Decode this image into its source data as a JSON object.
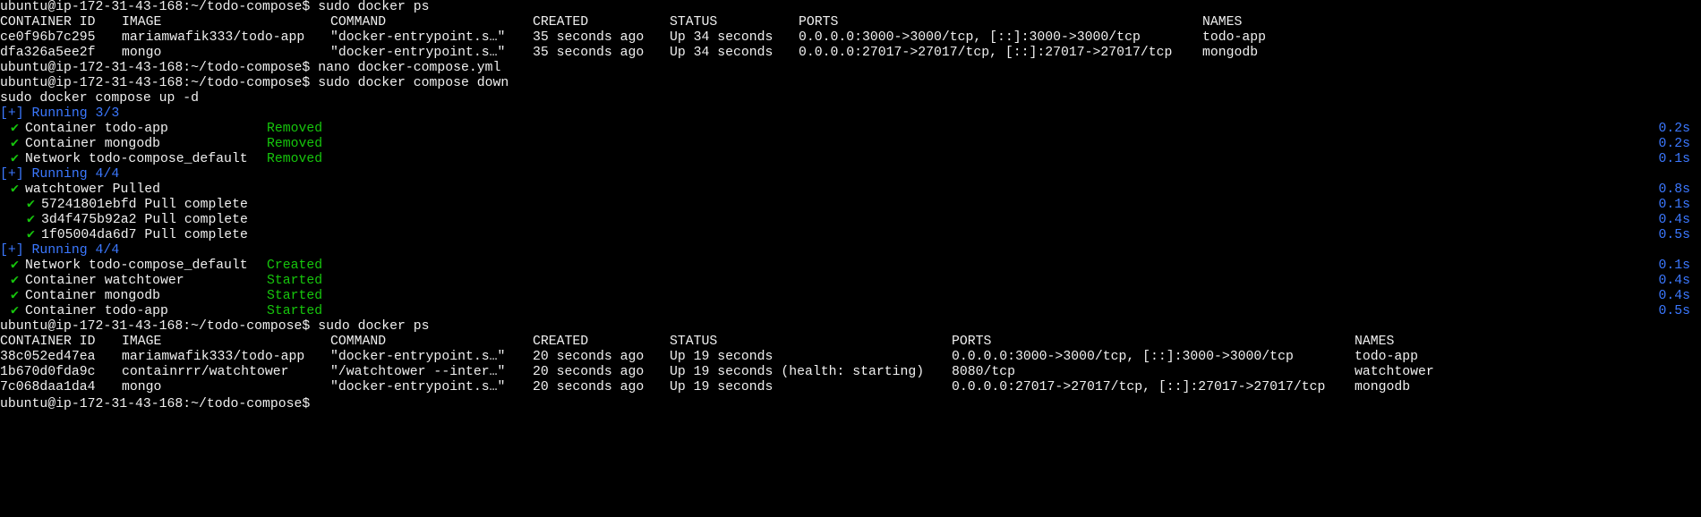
{
  "prompt": "ubuntu@ip-172-31-43-168:~/todo-compose$",
  "commands": {
    "docker_ps_1": "sudo docker ps",
    "nano": "nano docker-compose.yml",
    "compose_down": "sudo docker compose down",
    "compose_up": "sudo docker compose up -d",
    "docker_ps_2": "sudo docker ps"
  },
  "table_headers": {
    "container_id": "CONTAINER ID",
    "image": "IMAGE",
    "command": "COMMAND",
    "created": "CREATED",
    "status": "STATUS",
    "ports": "PORTS",
    "names": "NAMES"
  },
  "ps1_rows": [
    {
      "id": "ce0f96b7c295",
      "image": "mariamwafik333/todo-app",
      "command": "\"docker-entrypoint.s…\"",
      "created": "35 seconds ago",
      "status": "Up 34 seconds",
      "ports": "0.0.0.0:3000->3000/tcp, [::]:3000->3000/tcp",
      "names": "todo-app"
    },
    {
      "id": "dfa326a5ee2f",
      "image": "mongo",
      "command": "\"docker-entrypoint.s…\"",
      "created": "35 seconds ago",
      "status": "Up 34 seconds",
      "ports": "0.0.0.0:27017->27017/tcp, [::]:27017->27017/tcp",
      "names": "mongodb"
    }
  ],
  "progress": [
    {
      "kind": "header",
      "text": "[+] Running 3/3"
    },
    {
      "kind": "item",
      "check": "✔",
      "label": "Container todo-app",
      "state": "Removed",
      "time": "0.2s"
    },
    {
      "kind": "item",
      "check": "✔",
      "label": "Container mongodb",
      "state": "Removed",
      "time": "0.2s"
    },
    {
      "kind": "item",
      "check": "✔",
      "label": "Network todo-compose_default",
      "state": "Removed",
      "time": "0.1s"
    },
    {
      "kind": "header",
      "text": "[+] Running 4/4"
    },
    {
      "kind": "item",
      "check": "✔",
      "label": "watchtower Pulled",
      "state": "",
      "time": "0.8s"
    },
    {
      "kind": "subitem",
      "check": "✔",
      "label": "57241801ebfd Pull complete",
      "state": "",
      "time": "0.1s"
    },
    {
      "kind": "subitem",
      "check": "✔",
      "label": "3d4f475b92a2 Pull complete",
      "state": "",
      "time": "0.4s"
    },
    {
      "kind": "subitem",
      "check": "✔",
      "label": "1f05004da6d7 Pull complete",
      "state": "",
      "time": "0.5s"
    },
    {
      "kind": "header",
      "text": "[+] Running 4/4"
    },
    {
      "kind": "item",
      "check": "✔",
      "label": "Network todo-compose_default",
      "state": "Created",
      "time": "0.1s"
    },
    {
      "kind": "item",
      "check": "✔",
      "label": "Container watchtower",
      "state": "Started",
      "time": "0.4s"
    },
    {
      "kind": "item",
      "check": "✔",
      "label": "Container mongodb",
      "state": "Started",
      "time": "0.4s"
    },
    {
      "kind": "item",
      "check": "✔",
      "label": "Container todo-app",
      "state": "Started",
      "time": "0.5s"
    }
  ],
  "ps2_rows": [
    {
      "id": "38c052ed47ea",
      "image": "mariamwafik333/todo-app",
      "command": "\"docker-entrypoint.s…\"",
      "created": "20 seconds ago",
      "status": "Up 19 seconds",
      "ports": "0.0.0.0:3000->3000/tcp, [::]:3000->3000/tcp",
      "names": "todo-app"
    },
    {
      "id": "1b670d0fda9c",
      "image": "containrrr/watchtower",
      "command": "\"/watchtower --inter…\"",
      "created": "20 seconds ago",
      "status": "Up 19 seconds (health: starting)",
      "ports": "8080/tcp",
      "names": "watchtower"
    },
    {
      "id": "7c068daa1da4",
      "image": "mongo",
      "command": "\"docker-entrypoint.s…\"",
      "created": "20 seconds ago",
      "status": "Up 19 seconds",
      "ports": "0.0.0.0:27017->27017/tcp, [::]:27017->27017/tcp",
      "names": "mongodb"
    }
  ],
  "colors": {
    "background": "#000000",
    "text": "#f0f0f0",
    "running_header": "#3b78ff",
    "status_green": "#16c60c",
    "timing": "#3b78ff"
  }
}
